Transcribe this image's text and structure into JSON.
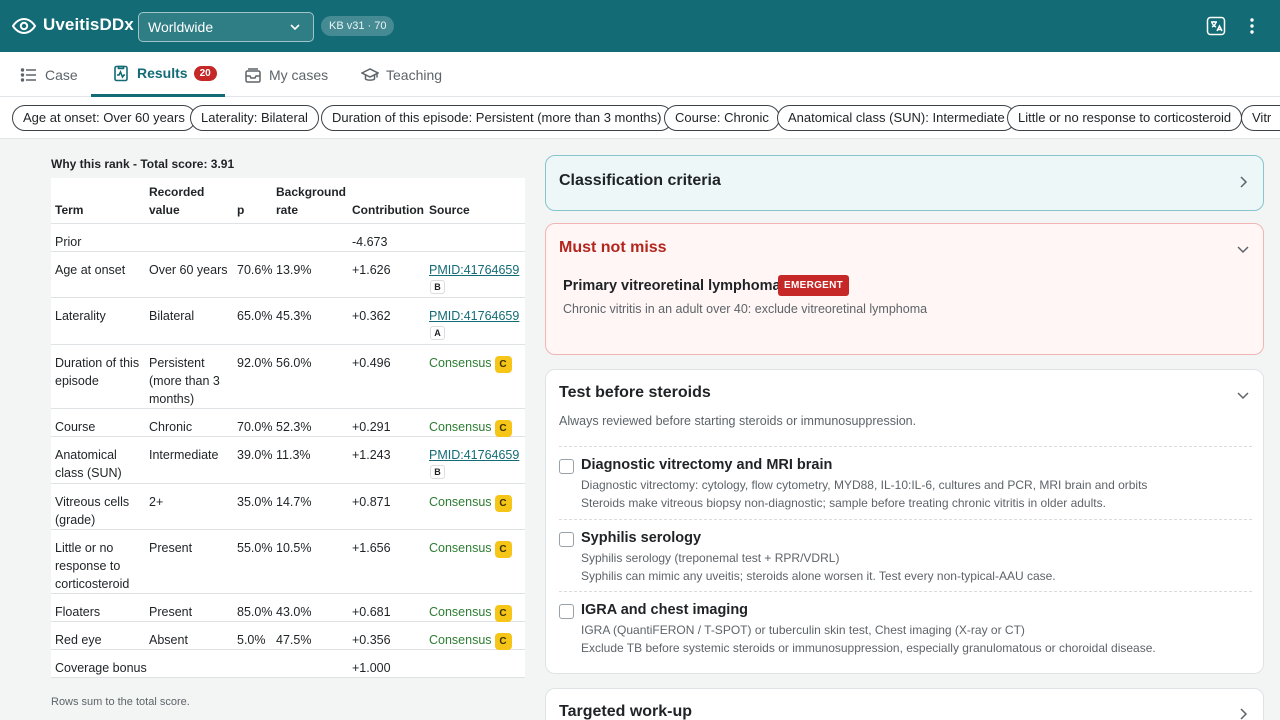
{
  "app": {
    "title": "UveitisDDx",
    "region": "Worldwide",
    "kb_version": "KB v31 · 70"
  },
  "tabs": [
    {
      "label": "Case",
      "icon": "list-icon"
    },
    {
      "label": "Results",
      "icon": "clipboard-pulse-icon",
      "badge": "20",
      "active": true
    },
    {
      "label": "My cases",
      "icon": "inbox-icon"
    },
    {
      "label": "Teaching",
      "icon": "graduation-cap-icon"
    }
  ],
  "chips": [
    "Age at onset: Over 60 years",
    "Laterality: Bilateral",
    "Duration of this episode: Persistent (more than 3 months)",
    "Course: Chronic",
    "Anatomical class (SUN): Intermediate",
    "Little or no response to corticosteroid",
    "Vitr"
  ],
  "score": {
    "title": "Why this rank - Total score: 3.91",
    "headers": {
      "term": "Term",
      "value": "Recorded value",
      "p": "p",
      "background": "Background rate",
      "contribution": "Contribution",
      "source": "Source"
    },
    "rows": [
      {
        "term": "Prior",
        "value": "",
        "p": "",
        "bg": "",
        "contrib": "-4.673",
        "source": "",
        "grade": ""
      },
      {
        "term": "Age at onset",
        "value": "Over 60 years",
        "p": "70.6%",
        "bg": "13.9%",
        "contrib": "+1.626",
        "source": "PMID:41764659",
        "grade": "B"
      },
      {
        "term": "Laterality",
        "value": "Bilateral",
        "p": "65.0%",
        "bg": "45.3%",
        "contrib": "+0.362",
        "source": "PMID:41764659",
        "grade": "A"
      },
      {
        "term": "Duration of this episode",
        "value": "Persistent (more than 3 months)",
        "p": "92.0%",
        "bg": "56.0%",
        "contrib": "+0.496",
        "source": "Consensus",
        "grade": "C"
      },
      {
        "term": "Course",
        "value": "Chronic",
        "p": "70.0%",
        "bg": "52.3%",
        "contrib": "+0.291",
        "source": "Consensus",
        "grade": "C"
      },
      {
        "term": "Anatomical class (SUN)",
        "value": "Intermediate",
        "p": "39.0%",
        "bg": "11.3%",
        "contrib": "+1.243",
        "source": "PMID:41764659",
        "grade": "B"
      },
      {
        "term": "Vitreous cells (grade)",
        "value": "2+",
        "p": "35.0%",
        "bg": "14.7%",
        "contrib": "+0.871",
        "source": "Consensus",
        "grade": "C"
      },
      {
        "term": "Little or no response to corticosteroid",
        "value": "Present",
        "p": "55.0%",
        "bg": "10.5%",
        "contrib": "+1.656",
        "source": "Consensus",
        "grade": "C"
      },
      {
        "term": "Floaters",
        "value": "Present",
        "p": "85.0%",
        "bg": "43.0%",
        "contrib": "+0.681",
        "source": "Consensus",
        "grade": "C"
      },
      {
        "term": "Red eye",
        "value": "Absent",
        "p": "5.0%",
        "bg": "47.5%",
        "contrib": "+0.356",
        "source": "Consensus",
        "grade": "C"
      },
      {
        "term": "Coverage bonus",
        "value": "",
        "p": "",
        "bg": "",
        "contrib": "+1.000",
        "source": "",
        "grade": ""
      }
    ],
    "footnote": "Rows sum to the total score."
  },
  "cards": {
    "classification": {
      "title": "Classification criteria"
    },
    "must_not_miss": {
      "title": "Must not miss",
      "dx": "Primary vitreoretinal lymphoma",
      "badge": "EMERGENT",
      "note": "Chronic vitritis in an adult over 40: exclude vitreoretinal lymphoma"
    },
    "test_before_steroids": {
      "title": "Test before steroids",
      "subtitle": "Always reviewed before starting steroids or immunosuppression.",
      "items": [
        {
          "name": "Diagnostic vitrectomy and MRI brain",
          "detail": "Diagnostic vitrectomy: cytology, flow cytometry, MYD88, IL-10:IL-6, cultures and PCR, MRI brain and orbits",
          "reason": "Steroids make vitreous biopsy non-diagnostic; sample before treating chronic vitritis in older adults."
        },
        {
          "name": "Syphilis serology",
          "detail": "Syphilis serology (treponemal test + RPR/VDRL)",
          "reason": "Syphilis can mimic any uveitis; steroids alone worsen it. Test every non-typical-AAU case."
        },
        {
          "name": "IGRA and chest imaging",
          "detail": "IGRA (QuantiFERON / T-SPOT) or tuberculin skin test, Chest imaging (X-ray or CT)",
          "reason": "Exclude TB before systemic steroids or immunosuppression, especially granulomatous or choroidal disease."
        }
      ]
    },
    "targeted_workup": {
      "title": "Targeted work-up"
    }
  },
  "colors": {
    "brand": "#136b75",
    "danger": "#c62828",
    "consensus": "#2e7d32",
    "grade_c": "#f5c518"
  }
}
